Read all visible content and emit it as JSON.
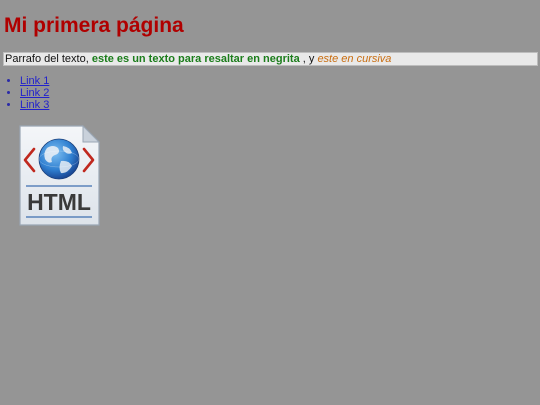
{
  "page": {
    "heading": "Mi primera página"
  },
  "paragraph": {
    "plain": "Parrafo del texto, ",
    "bold": "este es un texto para resaltar en negrita",
    "connector": " , y ",
    "italic": "este en cursiva"
  },
  "links": [
    {
      "label": "Link 1"
    },
    {
      "label": "Link 2"
    },
    {
      "label": "Link 3"
    }
  ],
  "image": {
    "icon": "html-file-icon",
    "label": "HTML"
  },
  "colors": {
    "background": "#959595",
    "heading": "#b00000",
    "bold_text": "#1b7d1b",
    "italic_text": "#c96d10",
    "link": "#2222cc"
  }
}
